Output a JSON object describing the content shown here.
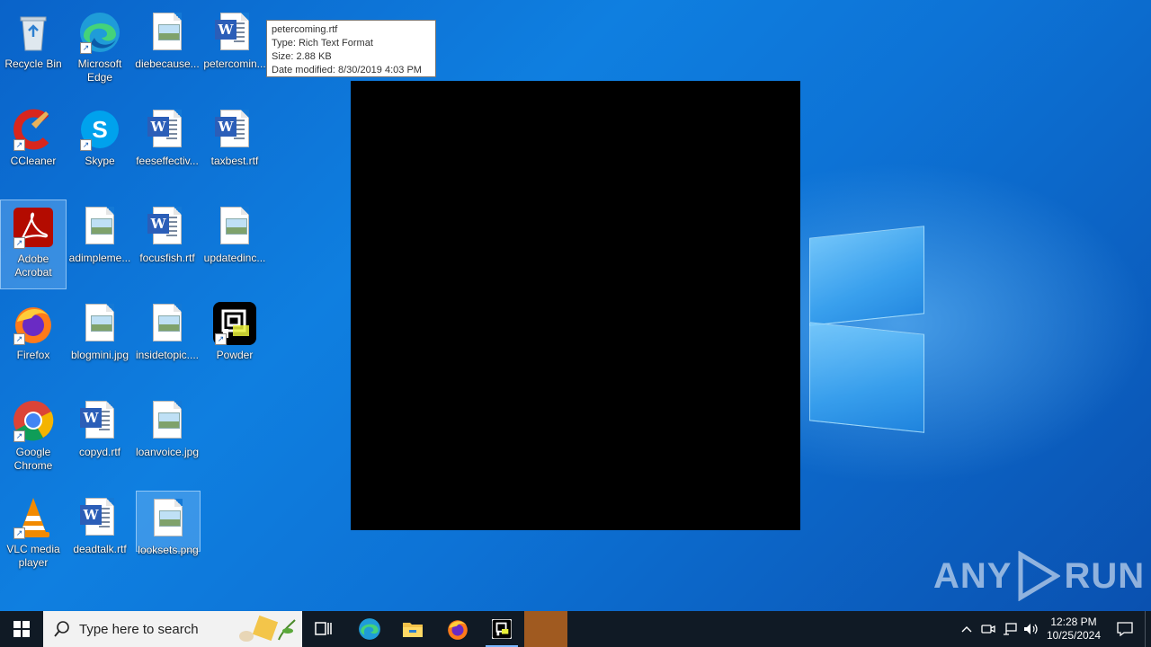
{
  "desktop_icons": [
    {
      "label": "Recycle Bin",
      "icon": "recycle-bin-icon"
    },
    {
      "label": "Microsoft Edge",
      "icon": "edge-icon"
    },
    {
      "label": "diebecause...",
      "icon": "image-file-icon"
    },
    {
      "label": "petercomin...",
      "icon": "word-rtf-icon"
    },
    {
      "label": "CCleaner",
      "icon": "ccleaner-icon"
    },
    {
      "label": "Skype",
      "icon": "skype-icon"
    },
    {
      "label": "feeseffectiv...",
      "icon": "word-rtf-icon"
    },
    {
      "label": "taxbest.rtf",
      "icon": "word-rtf-icon"
    },
    {
      "label": "Adobe Acrobat",
      "icon": "adobe-acrobat-icon"
    },
    {
      "label": "adimpleme...",
      "icon": "image-file-icon"
    },
    {
      "label": "focusfish.rtf",
      "icon": "word-rtf-icon"
    },
    {
      "label": "updatedinc...",
      "icon": "image-file-icon"
    },
    {
      "label": "Firefox",
      "icon": "firefox-icon"
    },
    {
      "label": "blogmini.jpg",
      "icon": "image-file-icon"
    },
    {
      "label": "insidetopic....",
      "icon": "image-file-icon"
    },
    {
      "label": "Powder",
      "icon": "powder-icon"
    },
    {
      "label": "Google Chrome",
      "icon": "chrome-icon"
    },
    {
      "label": "copyd.rtf",
      "icon": "word-rtf-icon"
    },
    {
      "label": "loanvoice.jpg",
      "icon": "image-file-icon"
    },
    {
      "label": "VLC media player",
      "icon": "vlc-icon"
    },
    {
      "label": "deadtalk.rtf",
      "icon": "word-rtf-icon"
    },
    {
      "label": "looksets.png",
      "icon": "image-file-icon"
    }
  ],
  "tooltip": {
    "name": "petercoming.rtf",
    "type": "Type: Rich Text Format",
    "size": "Size: 2.88 KB",
    "modified": "Date modified: 8/30/2019 4:03 PM"
  },
  "watermark": {
    "left": "ANY",
    "right": "RUN"
  },
  "taskbar": {
    "search_placeholder": "Type here to search",
    "clock_time": "12:28 PM",
    "clock_date": "10/25/2024",
    "pinned": [
      "start-icon",
      "task-view-icon",
      "edge-icon",
      "file-explorer-icon",
      "firefox-icon",
      "powder-icon"
    ]
  },
  "colors": {
    "taskbar_bg": "#101a25",
    "desktop_blue": "#0f7fe0",
    "selection": "#a0d2ff"
  }
}
